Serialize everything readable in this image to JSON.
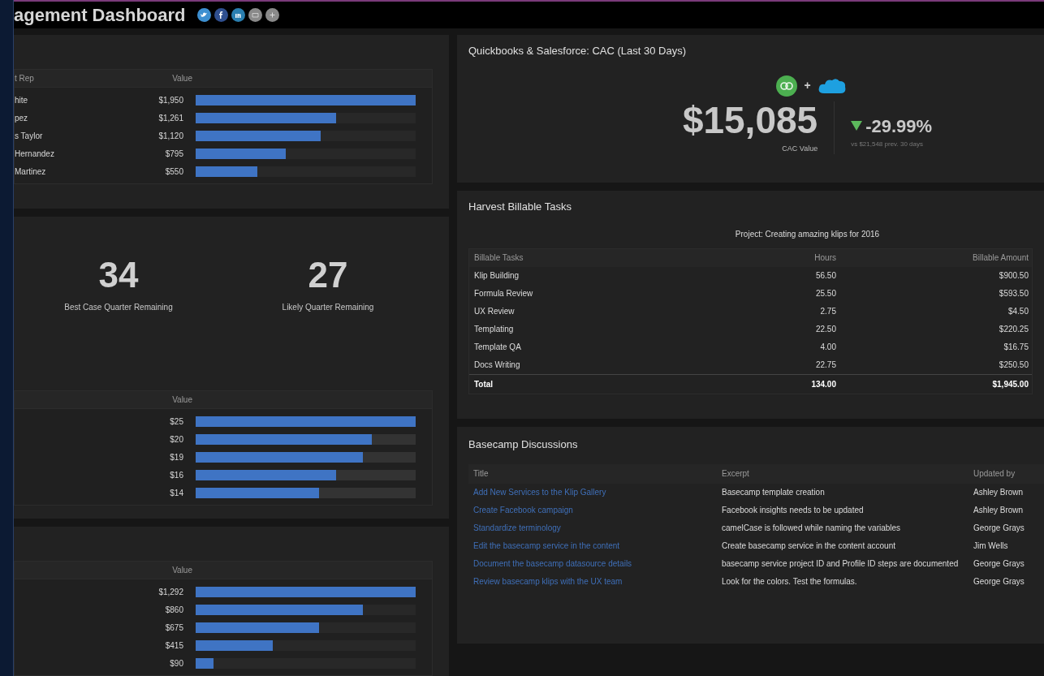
{
  "header": {
    "title": "agement Dashboard",
    "share_icons": [
      {
        "kind": "twitter",
        "color": "#3d8fd0"
      },
      {
        "kind": "facebook",
        "color": "#2f4f8f"
      },
      {
        "kind": "linkedin",
        "color": "#2a7fb0"
      },
      {
        "kind": "mail",
        "color": "#8a8a8a"
      },
      {
        "kind": "more",
        "color": "#8a8a8a"
      }
    ]
  },
  "left_panels": [
    {
      "kind": "bars",
      "columns": [
        "t Rep",
        "Value"
      ],
      "rows": [
        {
          "name": "hite",
          "value": "$1,950",
          "level": 1
        },
        {
          "name": "pez",
          "value": "$1,261",
          "level": 0.64
        },
        {
          "name": "s Taylor",
          "value": "$1,120",
          "level": 0.57
        },
        {
          "name": "Hernandez",
          "value": "$795",
          "level": 0.41
        },
        {
          "name": "Martinez",
          "value": "$550",
          "level": 0.28
        }
      ]
    },
    {
      "kind": "metrics_bars",
      "metrics": [
        {
          "value": "34",
          "label": "Best Case Quarter Remaining"
        },
        {
          "value": "27",
          "label": "Likely Quarter Remaining"
        }
      ],
      "columns": [
        "",
        "Value"
      ],
      "rows": [
        {
          "name": "",
          "value": "$25",
          "level": 1
        },
        {
          "name": "",
          "value": "$20",
          "level": 0.8
        },
        {
          "name": "",
          "value": "$19",
          "level": 0.76
        },
        {
          "name": "",
          "value": "$16",
          "level": 0.64
        },
        {
          "name": "",
          "value": "$14",
          "level": 0.56
        }
      ]
    },
    {
      "kind": "bars",
      "columns": [
        "",
        "Value"
      ],
      "rows": [
        {
          "name": "",
          "value": "$1,292",
          "level": 1
        },
        {
          "name": "",
          "value": "$860",
          "level": 0.76
        },
        {
          "name": "",
          "value": "$675",
          "level": 0.56
        },
        {
          "name": "",
          "value": "$415",
          "level": 0.35
        },
        {
          "name": "",
          "value": "$90",
          "level": 0.08
        }
      ]
    }
  ],
  "cac": {
    "title": "Quickbooks & Salesforce: CAC (Last 30 Days)",
    "plus": "+",
    "value": "$15,085",
    "label": "CAC Value",
    "change": "-29.99%",
    "decrease": true,
    "comparison": "vs $21,548 prev. 30 days"
  },
  "harvest": {
    "title": "Harvest Billable Tasks",
    "subtitle": "Project: Creating amazing klips for 2016",
    "columns": [
      "Billable Tasks",
      "Hours",
      "Billable Amount"
    ],
    "rows": [
      [
        "Klip Building",
        "56.50",
        "$900.50"
      ],
      [
        "Formula Review",
        "25.50",
        "$593.50"
      ],
      [
        "UX Review",
        "2.75",
        "$4.50"
      ],
      [
        "Templating",
        "22.50",
        "$220.25"
      ],
      [
        "Template QA",
        "4.00",
        "$16.75"
      ],
      [
        "Docs Writing",
        "22.75",
        "$250.50"
      ]
    ],
    "total": [
      "Total",
      "134.00",
      "$1,945.00"
    ]
  },
  "basecamp": {
    "title": "Basecamp Discussions",
    "columns": [
      "Title",
      "Excerpt",
      "Updated by"
    ],
    "rows": [
      [
        "Add New Services to the Klip Gallery",
        "Basecamp template creation",
        "Ashley Brown"
      ],
      [
        "Create Facebook campaign",
        "Facebook insights needs to be updated",
        "Ashley Brown"
      ],
      [
        "Standardize terminology",
        "camelCase is followed while naming the variables",
        "George Grays"
      ],
      [
        "Edit the basecamp service in the content",
        "Create basecamp service in the content account",
        "Jim Wells"
      ],
      [
        "Document the basecamp datasource details",
        "basecamp service project ID and Profile ID steps are documented",
        "George Grays"
      ],
      [
        "Review basecamp klips with the UX team",
        "Look for the colors. Test the formulas.",
        "George Grays"
      ]
    ]
  }
}
